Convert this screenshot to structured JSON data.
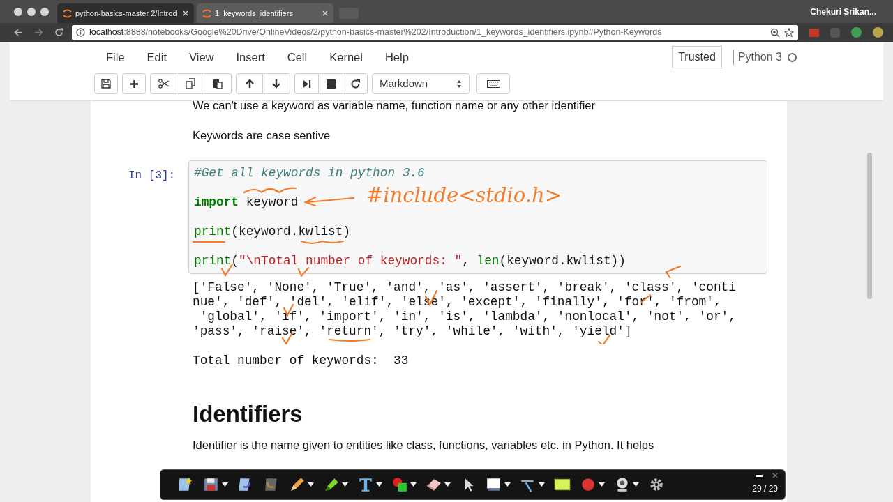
{
  "browser": {
    "tabs": [
      {
        "label": "python-basics-master 2/Introd",
        "selected": false
      },
      {
        "label": "1_keywords_identifiers",
        "selected": true
      }
    ],
    "profile": "Chekuri Srikan...",
    "url_host": "localhost",
    "url_rest": ":8888/notebooks/Google%20Drive/OnlineVideos/2/python-basics-master%202/Introduction/1_keywords_identifiers.ipynb#Python-Keywords"
  },
  "menu": [
    "File",
    "Edit",
    "View",
    "Insert",
    "Cell",
    "Kernel",
    "Help"
  ],
  "trusted": "Trusted",
  "kernel": "Python 3",
  "cell_type": "Markdown",
  "notebook": {
    "text_1": "We can't use a keyword as variable name, function name or any other identifier",
    "text_2": "Keywords are case sentive",
    "prompt": "In [3]:",
    "code": [
      [
        {
          "kind": "comment",
          "text": "#Get all keywords in python 3.6"
        }
      ],
      [
        {
          "kind": "keyword",
          "text": "import"
        },
        {
          "kind": "plain",
          "text": " keyword"
        }
      ],
      [
        {
          "kind": "builtin",
          "text": "print"
        },
        {
          "kind": "plain",
          "text": "(keyword.kwlist)"
        }
      ],
      [
        {
          "kind": "builtin",
          "text": "print"
        },
        {
          "kind": "plain",
          "text": "("
        },
        {
          "kind": "string",
          "text": "\"\\nTotal number of keywords: \""
        },
        {
          "kind": "plain",
          "text": ", "
        },
        {
          "kind": "builtin",
          "text": "len"
        },
        {
          "kind": "plain",
          "text": "(keyword.kwlist))"
        }
      ]
    ],
    "output": [
      "['False', 'None', 'True', 'and', 'as', 'assert', 'break', 'class', 'conti",
      "nue', 'def', 'del', 'elif', 'else', 'except', 'finally', 'for', 'from',",
      " 'global', 'if', 'import', 'in', 'is', 'lambda', 'nonlocal', 'not', 'or',",
      "'pass', 'raise', 'return', 'try', 'while', 'with', 'yield']",
      "Total number of keywords:  33"
    ],
    "heading": "Identifiers",
    "paragraph": "Identifier is the name given to entities like class, functions, variables etc. in Python. It helps"
  },
  "annotation": "#include<stdio.h>",
  "drawing_toolbar": {
    "page_count": "29 / 29"
  }
}
